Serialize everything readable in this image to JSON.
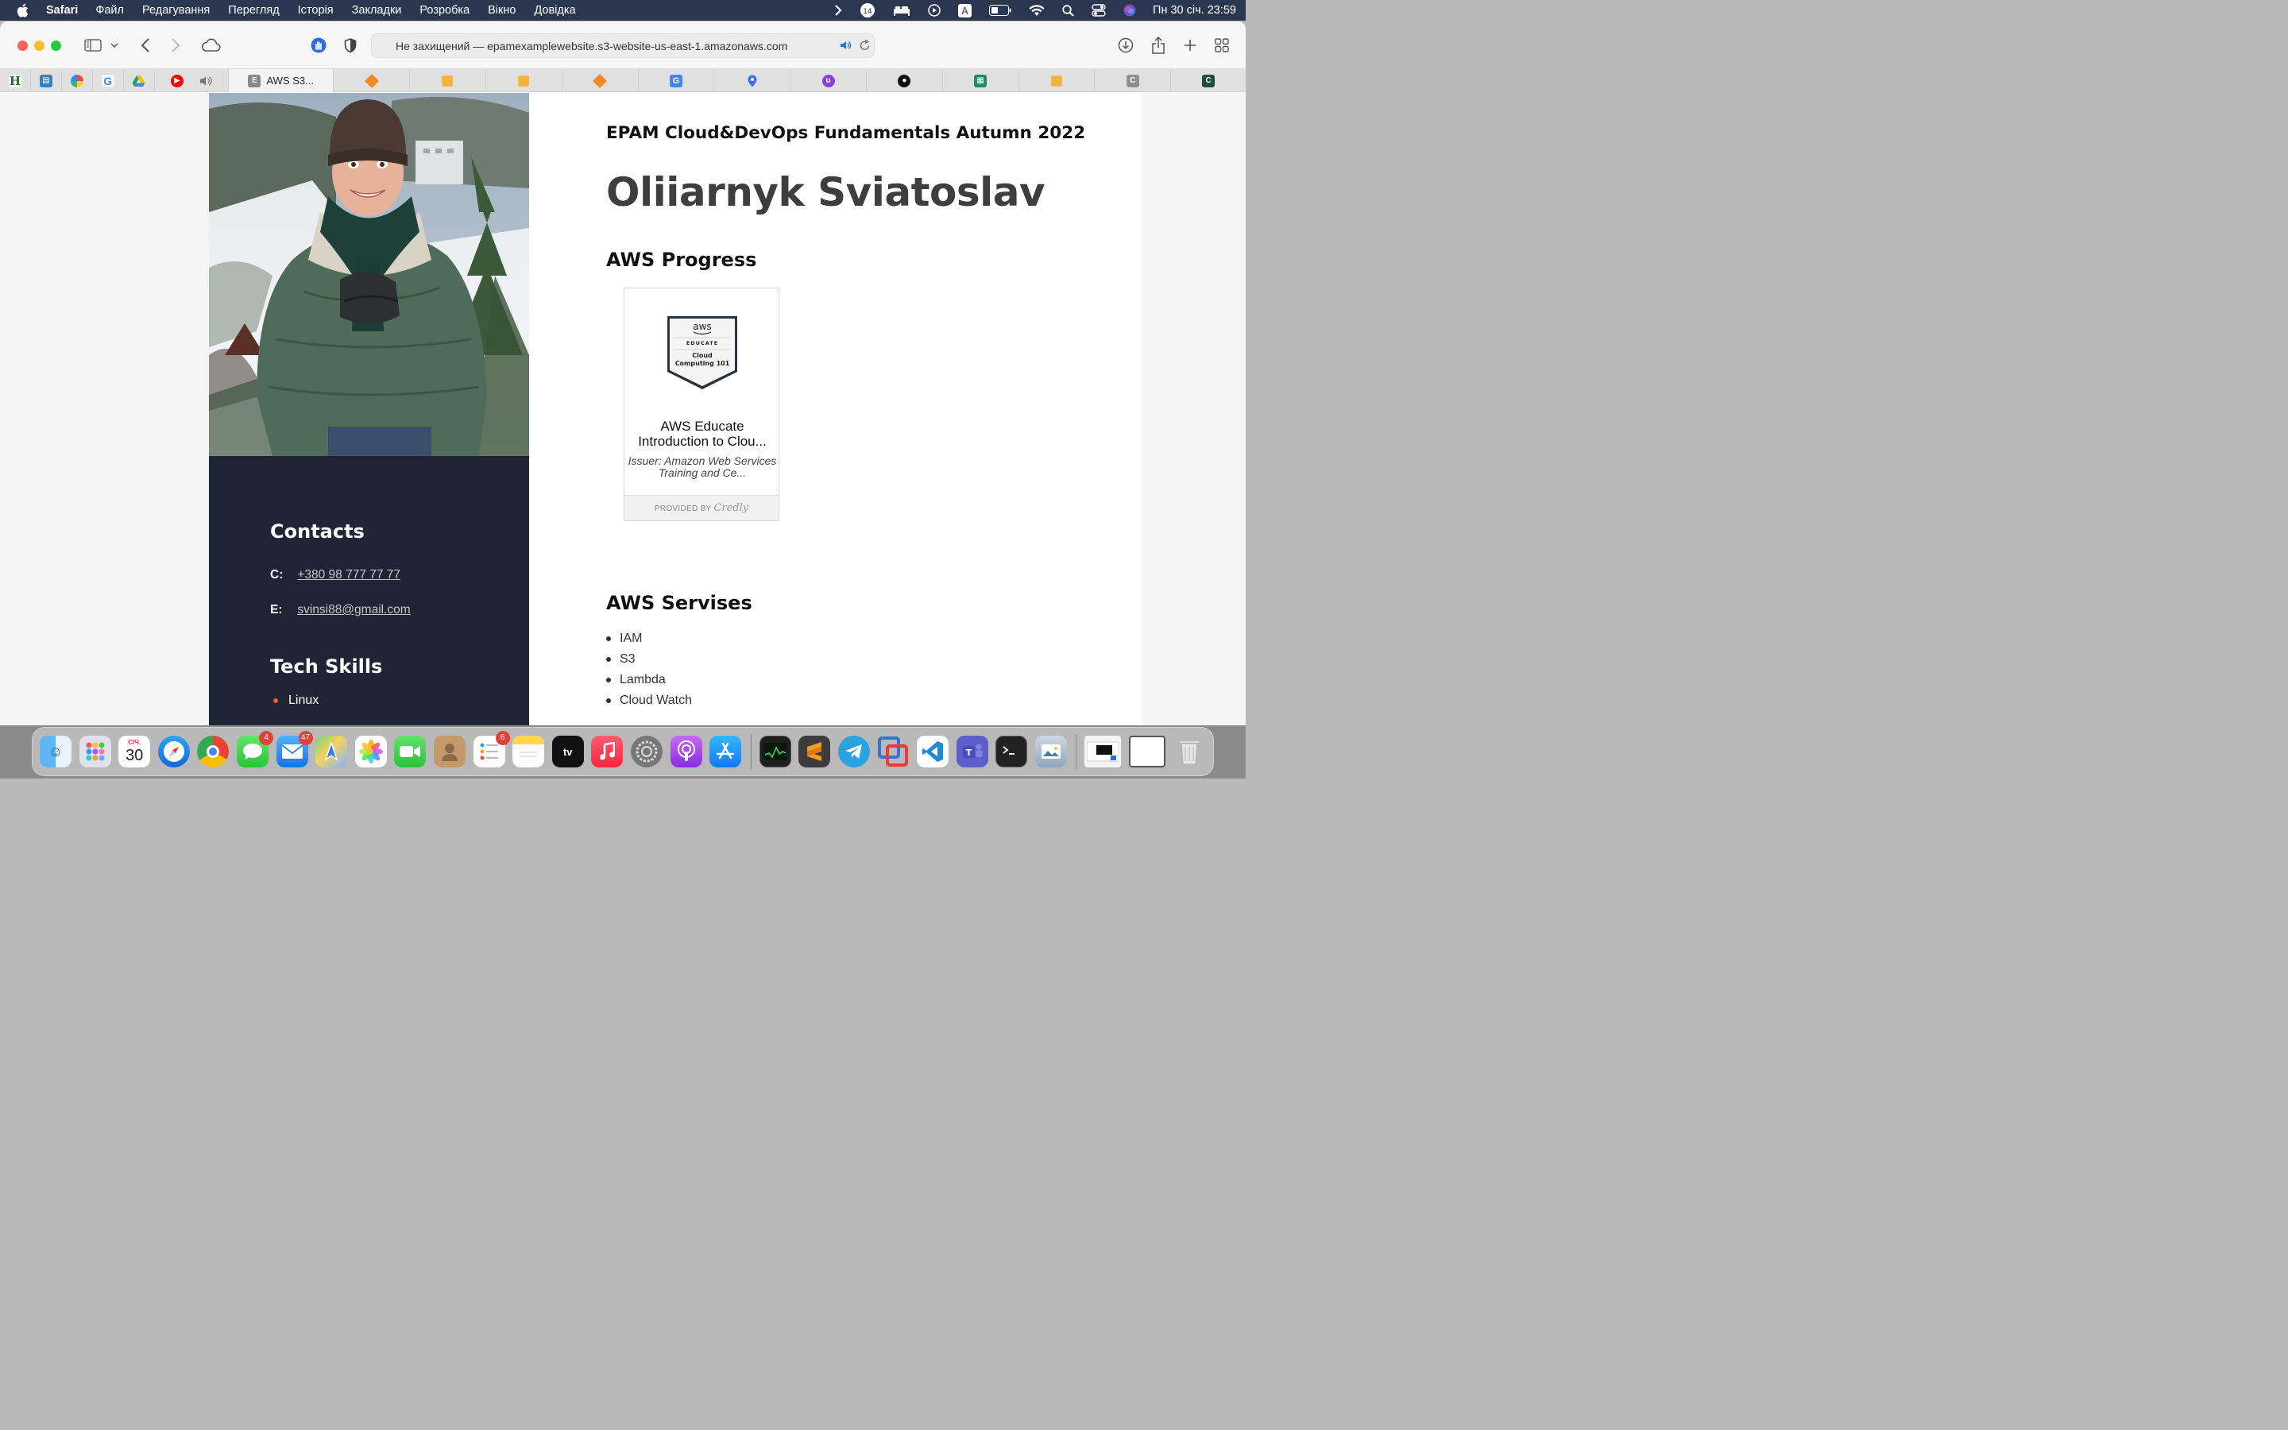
{
  "menubar": {
    "app": "Safari",
    "items": [
      "Файл",
      "Редагування",
      "Перегляд",
      "Історія",
      "Закладки",
      "Розробка",
      "Вікно",
      "Довідка"
    ],
    "date_time": "Пн 30 січ.  23:59",
    "notification_count": "14"
  },
  "browser": {
    "url": "Не захищений — epamexamplewebsite.s3-website-us-east-1.amazonaws.com",
    "active_tab_label": "AWS S3...",
    "active_tab_favicon": "E"
  },
  "page": {
    "course_title": "EPAM Cloud&DevOps Fundamentals Autumn 2022",
    "name": "Oliiarnyk Sviatoslav",
    "progress_heading": "AWS Progress",
    "badge": {
      "brand": "aws",
      "program": "EDUCATE",
      "line1": "Cloud",
      "line2": "Computing 101",
      "title": "AWS Educate Introduction to Clou...",
      "issuer": "Issuer: Amazon Web Services Training and Ce...",
      "footer_prefix": "PROVIDED BY",
      "footer_brand": "Credly"
    },
    "services_heading": "AWS Servises",
    "services": [
      "IAM",
      "S3",
      "Lambda",
      "Cloud Watch"
    ],
    "contacts": {
      "heading": "Contacts",
      "phone_label": "C:",
      "phone": "+380 98 777 77 77",
      "email_label": "E:",
      "email": "svinsi88@gmail.com"
    },
    "skills": {
      "heading": "Tech Skills",
      "items": [
        "Linux"
      ]
    }
  },
  "dock": {
    "calendar_month": "СІЧ.",
    "calendar_day": "30",
    "messages_badge": "4",
    "mail_badge": "47",
    "reminders_badge": "6"
  },
  "colors": {
    "left_column_bg": "#1f2535",
    "accent_bullet": "#e2653a",
    "menubar_bg": "#2b3750"
  }
}
